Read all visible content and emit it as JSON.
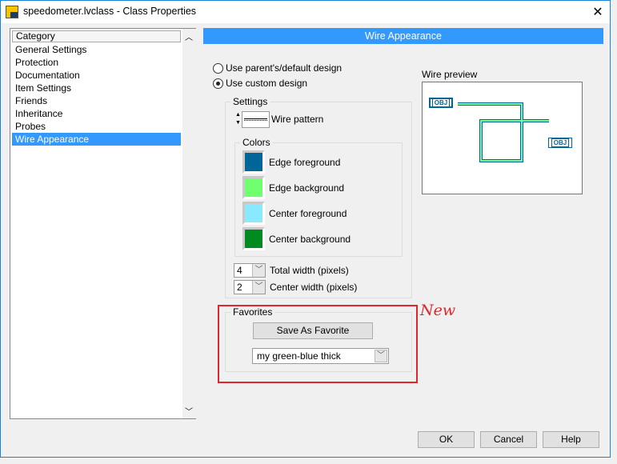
{
  "window": {
    "title": "speedometer.lvclass - Class Properties",
    "close_glyph": "✕"
  },
  "category": {
    "header": "Category",
    "items": [
      "General Settings",
      "Protection",
      "Documentation",
      "Item Settings",
      "Friends",
      "Inheritance",
      "Probes",
      "Wire Appearance"
    ],
    "selected": "Wire Appearance"
  },
  "panel": {
    "title": "Wire Appearance",
    "radio_parent": "Use parent's/default design",
    "radio_custom": "Use custom design",
    "selected_radio": "custom",
    "settings_label": "Settings",
    "wire_pattern_label": "Wire pattern",
    "colors_label": "Colors",
    "colors": [
      {
        "label": "Edge foreground",
        "color": "#006699"
      },
      {
        "label": "Edge background",
        "color": "#6fff6f"
      },
      {
        "label": "Center foreground",
        "color": "#8ae8ff"
      },
      {
        "label": "Center background",
        "color": "#008a1f"
      }
    ],
    "total_width": {
      "value": "4",
      "label": "Total width (pixels)"
    },
    "center_width": {
      "value": "2",
      "label": "Center width (pixels)"
    },
    "favorites_label": "Favorites",
    "save_favorite": "Save As Favorite",
    "favorite_selected": "my green-blue thick",
    "preview_label": "Wire preview",
    "terminal_label": "OBJ"
  },
  "annotation": {
    "new": "New",
    "color": "#e0252c"
  },
  "buttons": {
    "ok": "OK",
    "cancel": "Cancel",
    "help": "Help"
  }
}
